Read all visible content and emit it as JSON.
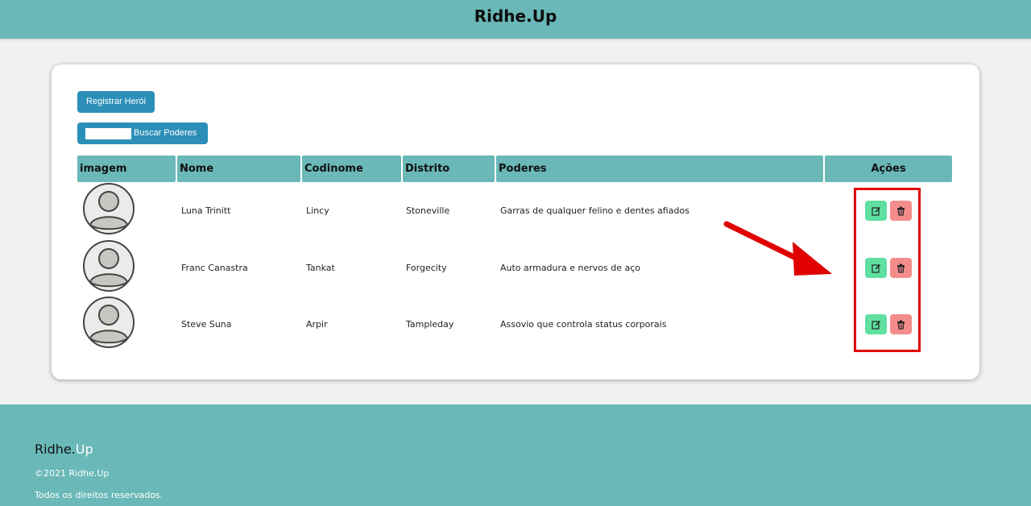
{
  "header": {
    "brand": "Ridhe.Up"
  },
  "toolbar": {
    "register_label": "Registrar Herói",
    "search_value": "",
    "search_button_label": "Buscar Poderes"
  },
  "table": {
    "columns": [
      "imagem",
      "Nome",
      "Codinome",
      "Distrito",
      "Poderes",
      "Ações"
    ],
    "rows": [
      {
        "nome": "Luna Trinitt",
        "codinome": "Lincy",
        "distrito": "Stoneville",
        "poderes": "Garras de qualquer felino e dentes afiados"
      },
      {
        "nome": "Franc Canastra",
        "codinome": "Tankat",
        "distrito": "Forgecity",
        "poderes": "Auto armadura e nervos de aço"
      },
      {
        "nome": "Steve Suna",
        "codinome": "Arpir",
        "distrito": "Tampleday",
        "poderes": "Assovio que controla status corporais"
      }
    ]
  },
  "icons": {
    "avatar": "user-avatar-icon",
    "edit": "edit-icon",
    "delete": "trash-icon"
  },
  "colors": {
    "primary": "#6ab8b8",
    "button": "#2c8fb8",
    "edit": "#5fe0a0",
    "delete": "#f58c8c",
    "annotation": "#e00000"
  },
  "footer": {
    "brand_main": "Ridhe.",
    "brand_accent": "Up",
    "copyright": "©2021 Ridhe.Up",
    "rights": "Todos os direitos reservados."
  }
}
